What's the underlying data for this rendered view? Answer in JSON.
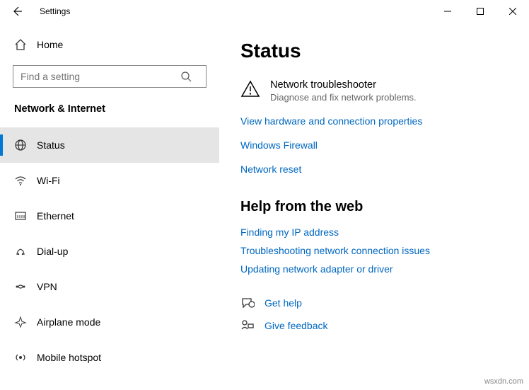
{
  "window": {
    "title": "Settings"
  },
  "sidebar": {
    "home": "Home",
    "search_placeholder": "Find a setting",
    "category": "Network & Internet",
    "items": [
      {
        "label": "Status"
      },
      {
        "label": "Wi-Fi"
      },
      {
        "label": "Ethernet"
      },
      {
        "label": "Dial-up"
      },
      {
        "label": "VPN"
      },
      {
        "label": "Airplane mode"
      },
      {
        "label": "Mobile hotspot"
      }
    ]
  },
  "main": {
    "title": "Status",
    "troubleshooter": {
      "title": "Network troubleshooter",
      "subtitle": "Diagnose and fix network problems."
    },
    "links": [
      "View hardware and connection properties",
      "Windows Firewall",
      "Network reset"
    ],
    "help_heading": "Help from the web",
    "help_links": [
      "Finding my IP address",
      "Troubleshooting network connection issues",
      "Updating network adapter or driver"
    ],
    "bottom": {
      "get_help": "Get help",
      "give_feedback": "Give feedback"
    }
  },
  "watermark": "wsxdn.com"
}
